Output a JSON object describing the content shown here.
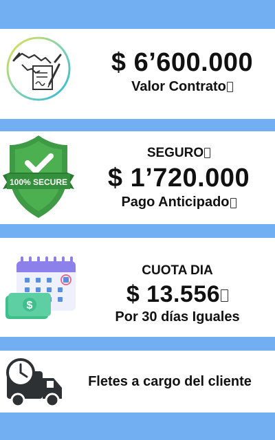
{
  "contract": {
    "amount": "$ 6’600.000",
    "label": "Valor Contrato"
  },
  "insurance": {
    "badge_text": "100% SECURE",
    "title": "SEGURO",
    "amount": "$ 1’720.000",
    "label": "Pago Anticipado"
  },
  "daily_fee": {
    "title": "CUOTA DIA",
    "amount": "$ 13.556",
    "label": "Por 30 días Iguales"
  },
  "shipping": {
    "label": "Fletes a cargo del cliente"
  },
  "colors": {
    "band": "#72aef2",
    "panel": "#ffffff",
    "shield": "#3e9a44",
    "shield_dark": "#2d7a34",
    "calendar_blue": "#5b8de0",
    "calendar_purple": "#8c80ea",
    "money_green": "#5ecfa3",
    "truck": "#2d3134"
  },
  "icons": [
    "handshake-contract-icon",
    "secure-shield-icon",
    "calendar-money-icon",
    "truck-clock-icon"
  ]
}
